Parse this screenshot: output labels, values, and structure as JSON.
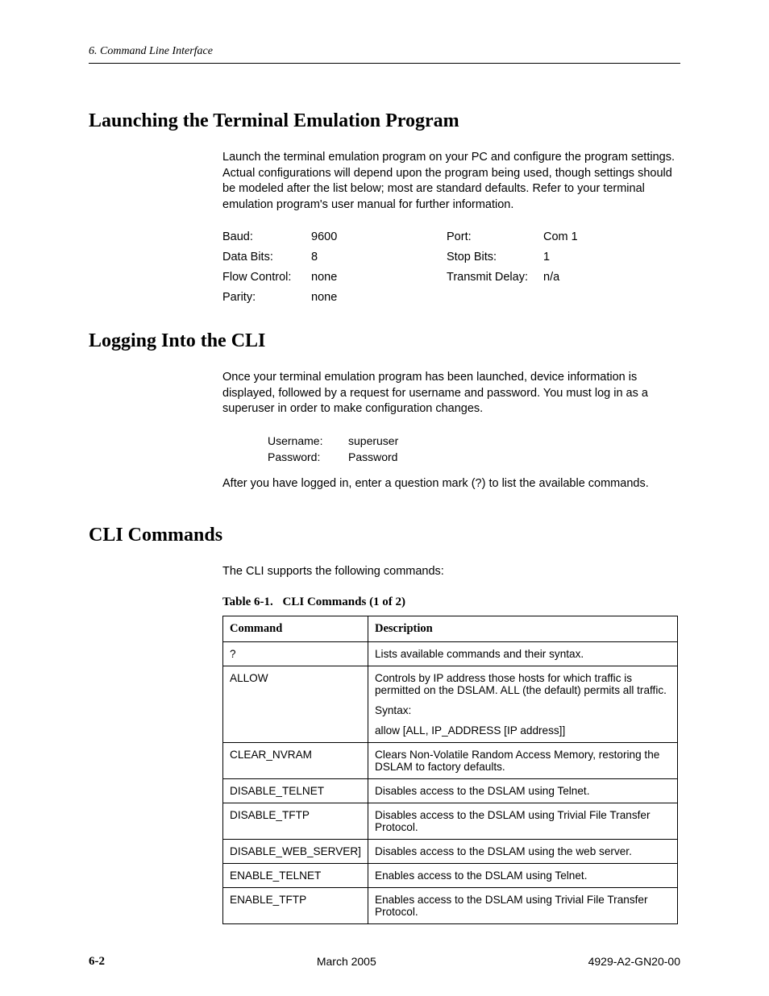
{
  "header": "6. Command Line Interface",
  "section1": {
    "title": "Launching the Terminal Emulation Program",
    "body": "Launch the terminal emulation program on your PC and configure the program settings. Actual configurations will depend upon the program being used, though settings should be modeled after the list below; most are standard defaults. Refer to your terminal emulation program's user manual for further information.",
    "settings_left": [
      {
        "label": "Baud:",
        "value": "9600"
      },
      {
        "label": "Data Bits:",
        "value": "8"
      },
      {
        "label": "Flow Control:",
        "value": "none"
      },
      {
        "label": "Parity:",
        "value": "none"
      }
    ],
    "settings_right": [
      {
        "label": "Port:",
        "value": "Com 1"
      },
      {
        "label": "Stop Bits:",
        "value": "1"
      },
      {
        "label": "Transmit Delay:",
        "value": "n/a"
      }
    ]
  },
  "section2": {
    "title": "Logging Into the CLI",
    "body1": "Once your terminal emulation program has been launched, device information is displayed, followed by a request for username and password. You must log in as a superuser in order to make configuration changes.",
    "creds": [
      {
        "label": "Username:",
        "value": "superuser"
      },
      {
        "label": "Password:",
        "value": "Password"
      }
    ],
    "body2": "After you have logged in, enter a question mark (?) to list the available commands."
  },
  "section3": {
    "title": "CLI Commands",
    "body": "The CLI supports the following commands:",
    "table_caption_num": "Table 6-1.",
    "table_caption_title": "CLI Commands (1 of 2)",
    "headers": {
      "c1": "Command",
      "c2": "Description"
    },
    "rows": [
      {
        "cmd": "?",
        "desc": [
          "Lists available commands and their syntax."
        ]
      },
      {
        "cmd": "ALLOW",
        "desc": [
          "Controls by IP address those hosts for which traffic is permitted on the DSLAM. ALL (the default) permits all traffic.",
          "Syntax:",
          "allow [ALL, IP_ADDRESS [IP address]]"
        ]
      },
      {
        "cmd": "CLEAR_NVRAM",
        "desc": [
          "Clears Non-Volatile Random Access Memory, restoring the DSLAM to factory defaults."
        ]
      },
      {
        "cmd": "DISABLE_TELNET",
        "desc": [
          "Disables access to the DSLAM using Telnet."
        ]
      },
      {
        "cmd": "DISABLE_TFTP",
        "desc": [
          "Disables access to the DSLAM using Trivial File Transfer Protocol."
        ]
      },
      {
        "cmd": "DISABLE_WEB_SERVER]",
        "desc": [
          "Disables access to the DSLAM using the web server."
        ]
      },
      {
        "cmd": "ENABLE_TELNET",
        "desc": [
          "Enables access to the DSLAM using Telnet."
        ]
      },
      {
        "cmd": "ENABLE_TFTP",
        "desc": [
          "Enables access to the DSLAM using Trivial File Transfer Protocol."
        ]
      }
    ]
  },
  "footer": {
    "page": "6-2",
    "date": "March 2005",
    "docnum": "4929-A2-GN20-00"
  }
}
